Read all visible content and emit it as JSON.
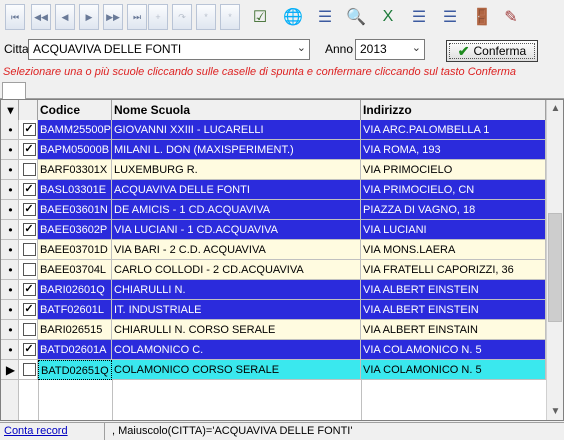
{
  "toolbar": {
    "buttons": [
      {
        "name": "first-record-button",
        "glyph": "⏮"
      },
      {
        "name": "prev-page-button",
        "glyph": "◀◀"
      },
      {
        "name": "prev-record-button",
        "glyph": "◀"
      },
      {
        "name": "next-record-button",
        "glyph": "▶"
      },
      {
        "name": "next-page-button",
        "glyph": "▶▶"
      },
      {
        "name": "last-record-button",
        "glyph": "⏭"
      },
      {
        "name": "add-record-button",
        "glyph": "+"
      },
      {
        "name": "refresh-button",
        "glyph": "↷"
      },
      {
        "name": "asterisk-button",
        "glyph": "*"
      },
      {
        "name": "clear-button",
        "glyph": "*"
      }
    ],
    "tools": [
      {
        "name": "checklist-icon",
        "glyph": "☑"
      },
      {
        "name": "globe-icon",
        "glyph": "🌐"
      },
      {
        "name": "list-filter-icon",
        "glyph": "☰"
      },
      {
        "name": "search-icon",
        "glyph": "🔍"
      },
      {
        "name": "excel-export-icon",
        "glyph": "X"
      },
      {
        "name": "list-view-icon",
        "glyph": "☰"
      },
      {
        "name": "detail-view-icon",
        "glyph": "☰"
      },
      {
        "name": "exit-door-icon",
        "glyph": "🚪"
      },
      {
        "name": "edit-list-icon",
        "glyph": "✎"
      }
    ]
  },
  "filters": {
    "city_label": "Citta",
    "city_value": "ACQUAVIVA DELLE FONTI",
    "year_label": "Anno",
    "year_value": "2013",
    "confirm_label": "Conferma"
  },
  "hint": "Selezionare una o più scuole cliccando sulle caselle di spunta e confermare cliccando sul tasto Conferma",
  "grid": {
    "columns": {
      "code": "Codice",
      "name": "Nome Scuola",
      "address": "Indirizzo"
    },
    "rows": [
      {
        "state": "sel",
        "code": "BAMM25500P",
        "name": "GIOVANNI XXIII - LUCARELLI",
        "address": "VIA ARC.PALOMBELLA 1"
      },
      {
        "state": "sel",
        "code": "BAPM05000B",
        "name": "MILANI L. DON (MAXISPERIMENT.)",
        "address": "VIA ROMA, 193"
      },
      {
        "state": "unsel",
        "code": "BARF03301X",
        "name": "LUXEMBURG R.",
        "address": "VIA PRIMOCIELO"
      },
      {
        "state": "sel",
        "code": "BASL03301E",
        "name": "ACQUAVIVA DELLE FONTI",
        "address": "VIA PRIMOCIELO, CN"
      },
      {
        "state": "sel",
        "code": "BAEE03601N",
        "name": "DE AMICIS - 1 CD.ACQUAVIVA",
        "address": "PIAZZA DI VAGNO, 18"
      },
      {
        "state": "sel",
        "code": "BAEE03602P",
        "name": "VIA LUCIANI - 1 CD.ACQUAVIVA",
        "address": "VIA LUCIANI"
      },
      {
        "state": "unsel",
        "code": "BAEE03701D",
        "name": "VIA BARI - 2 C.D. ACQUAVIVA",
        "address": "VIA MONS.LAERA"
      },
      {
        "state": "unsel",
        "code": "BAEE03704L",
        "name": "CARLO COLLODI - 2 CD.ACQUAVIVA",
        "address": "VIA FRATELLI CAPORIZZI, 36"
      },
      {
        "state": "sel",
        "code": "BARI02601Q",
        "name": "CHIARULLI N.",
        "address": "VIA ALBERT EINSTEIN"
      },
      {
        "state": "sel",
        "code": "BATF02601L",
        "name": "IT. INDUSTRIALE",
        "address": "VIA ALBERT EINSTEIN"
      },
      {
        "state": "unsel",
        "code": "BARI026515",
        "name": "CHIARULLI N. CORSO SERALE",
        "address": "VIA ALBERT EINSTAIN"
      },
      {
        "state": "sel",
        "code": "BATD02601A",
        "name": "COLAMONICO C.",
        "address": "VIA COLAMONICO N. 5"
      },
      {
        "state": "cur",
        "code": "BATD02651Q",
        "name": "COLAMONICO CORSO SERALE",
        "address": "VIA COLAMONICO N. 5"
      }
    ]
  },
  "status": {
    "count_link": "Conta record",
    "filter_text": ", Maiuscolo(CITTA)='ACQUAVIVA DELLE FONTI'"
  }
}
